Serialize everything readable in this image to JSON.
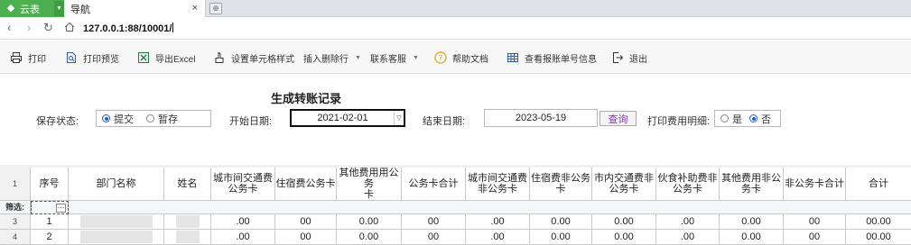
{
  "browser": {
    "app_name": "云表",
    "tab_title": "导航",
    "tab_close": "×",
    "url": "127.0.0.1:88/10001/"
  },
  "toolbar": {
    "items": [
      {
        "label": "打印",
        "icon": "printer-icon"
      },
      {
        "label": "打印预览",
        "icon": "print-preview-icon"
      },
      {
        "label": "导出Excel",
        "icon": "excel-icon"
      },
      {
        "label": "设置单元格样式",
        "icon": "format-brush-icon"
      },
      {
        "label": "插入删除行",
        "icon": "",
        "dropdown": true
      },
      {
        "label": "联系客服",
        "icon": "",
        "dropdown": true
      },
      {
        "label": "帮助文档",
        "icon": "help-icon"
      },
      {
        "label": "查看报账单号信息",
        "icon": "table-icon"
      },
      {
        "label": "退出",
        "icon": "exit-icon"
      }
    ]
  },
  "form": {
    "title": "生成转账记录",
    "save_status_label": "保存状态:",
    "save_status_options": [
      "提交",
      "暂存"
    ],
    "save_status_selected": "提交",
    "start_date_label": "开始日期:",
    "start_date": "2021-02-01",
    "end_date_label": "结束日期:",
    "end_date": "2023-05-19",
    "query_button": "查询",
    "print_detail_label": "打印费用明细:",
    "print_detail_options": [
      "是",
      "否"
    ],
    "print_detail_selected": "否"
  },
  "grid": {
    "header_row_number": "1",
    "columns": [
      "序号",
      "部门名称",
      "姓名",
      "城市间交通费\n公务卡",
      "住宿费公务卡",
      "其他费用用公务\n卡",
      "公务卡合计",
      "城市间交通费\n非公务卡",
      "住宿费非公务\n卡",
      "市内交通费非\n公务卡",
      "伙食补助费非\n公务卡",
      "其他费用非公\n务卡",
      "非公务卡合计",
      "合计"
    ],
    "filter_label": "筛选:",
    "filter_button": "···",
    "rows": [
      {
        "row_number": "3",
        "seq": "1",
        "values": [
          ".00",
          "00",
          "0.00",
          "00",
          ".00",
          "0.00",
          "0.00",
          ".00",
          "0.00",
          "00",
          "00.00"
        ]
      },
      {
        "row_number": "4",
        "seq": "2",
        "values": [
          ".00",
          "00",
          "0.00",
          "00",
          ".00",
          "0.00",
          "0.00",
          ".00",
          "0.00",
          "00",
          "00.00"
        ]
      }
    ]
  }
}
